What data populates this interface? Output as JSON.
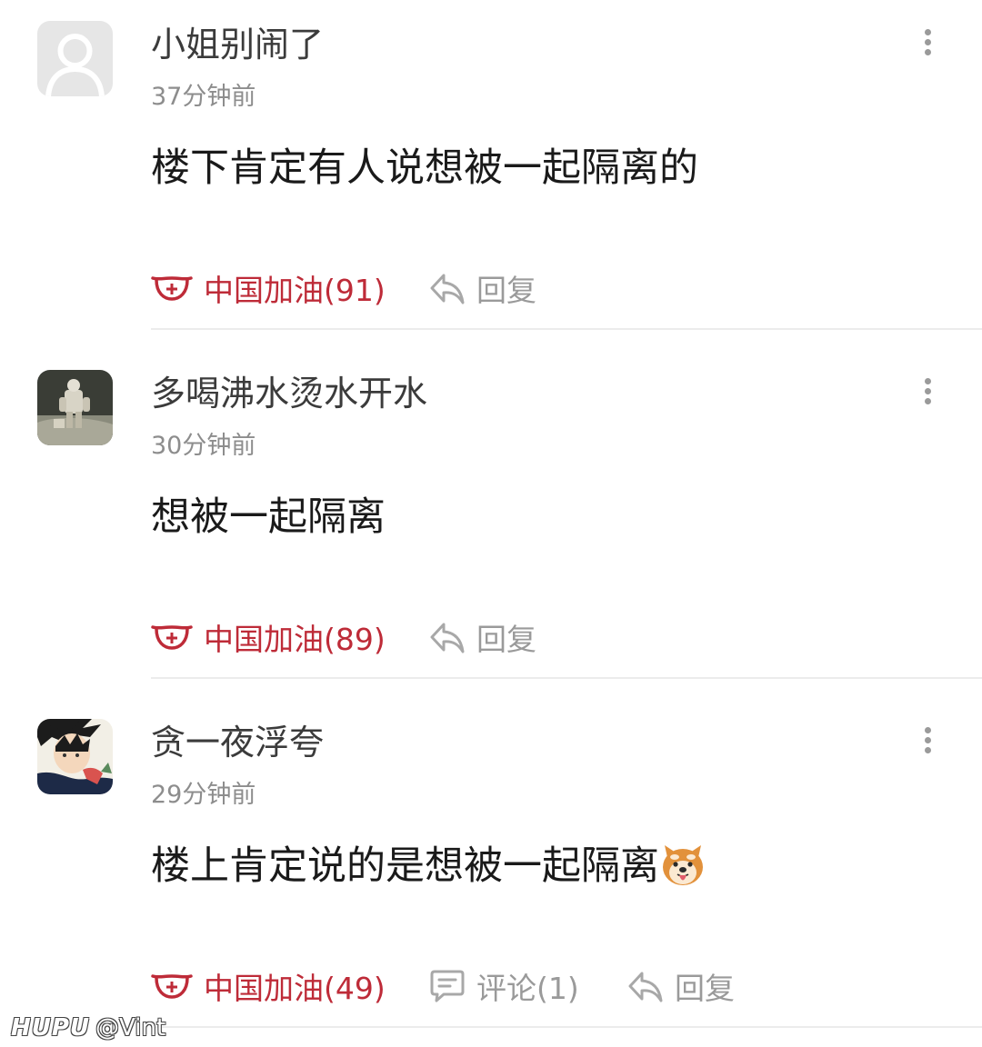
{
  "comments": [
    {
      "username": "小姐别闹了",
      "time": "37分钟前",
      "content": "楼下肯定有人说想被一起隔离的",
      "has_emoji": false,
      "avatar": "default-avatar",
      "like_label": "中国加油(91)",
      "reply_label": "回复"
    },
    {
      "username": "多喝沸水烫水开水",
      "time": "30分钟前",
      "content": "想被一起隔离",
      "has_emoji": false,
      "avatar": "photo-avatar",
      "like_label": "中国加油(89)",
      "reply_label": "回复"
    },
    {
      "username": "贪一夜浮夸",
      "time": "29分钟前",
      "content": "楼上肯定说的是想被一起隔离",
      "has_emoji": true,
      "emoji": "shiba-dog-emoji",
      "avatar": "anime-avatar",
      "like_label": "中国加油(49)",
      "comment_label": "评论(1)",
      "reply_label": "回复"
    }
  ],
  "watermark": {
    "logo": "HUPU",
    "handle": "@Vint"
  },
  "icons": {
    "more": "more-vertical-icon",
    "like": "mask-cross-icon",
    "reply": "reply-arrow-icon",
    "comment": "comment-bubble-icon"
  },
  "colors": {
    "accent": "#be2b38",
    "muted": "#9a9a9a",
    "text": "#1a1a1a"
  }
}
